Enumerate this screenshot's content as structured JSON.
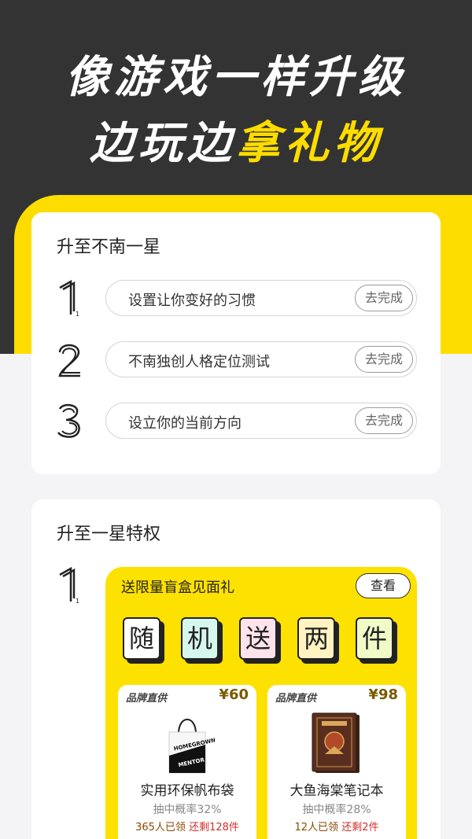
{
  "headline": {
    "line1": "像游戏一样升级",
    "line2_prefix": "边玩边",
    "line2_accent": "拿礼物"
  },
  "colors": {
    "dark_bg": "#333333",
    "accent_yellow": "#fddc00",
    "card_bg": "#ffffff",
    "page_bg": "#f4f4f6"
  },
  "level_card": {
    "title": "升至不南一星",
    "steps": [
      {
        "num": "1",
        "text": "设置让你变好的习惯",
        "button": "去完成"
      },
      {
        "num": "2",
        "text": "不南独创人格定位测试",
        "button": "去完成"
      },
      {
        "num": "3",
        "text": "设立你的当前方向",
        "button": "去完成"
      }
    ]
  },
  "privilege_card": {
    "title": "升至一星特权",
    "step_num": "1",
    "gift": {
      "title": "送限量盲盒见面礼",
      "view_button": "查看",
      "tiles": [
        {
          "char": "随",
          "color": "#ffffff"
        },
        {
          "char": "机",
          "color": "#d6f7ee"
        },
        {
          "char": "送",
          "color": "#ffe3ec"
        },
        {
          "char": "两",
          "color": "#fff3c2"
        },
        {
          "char": "件",
          "color": "#f1fbc8"
        }
      ],
      "prizes": [
        {
          "brand": "品牌直供",
          "price": "¥60",
          "name": "实用环保帆布袋",
          "prob": "抽中概率32%",
          "claimed": "365人已领",
          "remaining": "还剩128件",
          "icon": "tote-bag-icon"
        },
        {
          "brand": "品牌直供",
          "price": "¥98",
          "name": "大鱼海棠笔记本",
          "prob": "抽中概率28%",
          "claimed": "12人已领",
          "remaining": "还剩2件",
          "icon": "notebook-icon"
        }
      ]
    }
  }
}
